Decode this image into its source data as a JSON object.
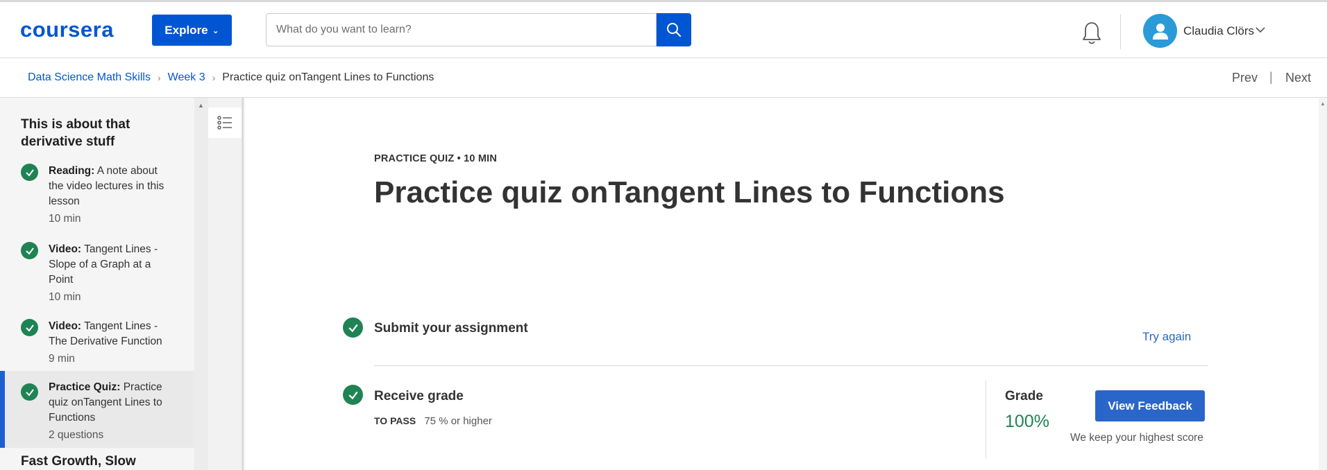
{
  "header": {
    "logo_text": "coursera",
    "explore_label": "Explore",
    "search_placeholder": "What do you want to learn?",
    "user_name": "Claudia Clörs",
    "brand_color": "#0056d2"
  },
  "breadcrumb": {
    "items": [
      "Data Science Math Skills",
      "Week 3"
    ],
    "current": "Practice quiz onTangent Lines to Functions",
    "prev_label": "Prev",
    "separator": "|",
    "next_label": "Next"
  },
  "sidebar": {
    "section_title": "This is about that derivative stuff",
    "items": [
      {
        "type": "Reading:",
        "title": "A note about the video lectures in this lesson",
        "meta": "10 min",
        "completed": true
      },
      {
        "type": "Video:",
        "title": "Tangent Lines - Slope of a Graph at a Point",
        "meta": "10 min",
        "completed": true
      },
      {
        "type": "Video:",
        "title": "Tangent Lines - The Derivative Function",
        "meta": "9 min",
        "completed": true
      },
      {
        "type": "Practice Quiz:",
        "title": "Practice quiz onTangent Lines to Functions",
        "meta": "2 questions",
        "completed": true,
        "active": true
      }
    ],
    "next_section_title": "Fast Growth, Slow"
  },
  "main": {
    "eyebrow": "PRACTICE QUIZ • 10 MIN",
    "title": "Practice quiz onTangent Lines to Functions",
    "steps": {
      "submit_label": "Submit your assignment",
      "try_again_label": "Try again",
      "receive_label": "Receive grade",
      "to_pass_label": "TO PASS",
      "to_pass_value": "75 % or higher"
    },
    "grade": {
      "label": "Grade",
      "value": "100%",
      "feedback_button": "View Feedback",
      "note": "We keep your highest score"
    },
    "success_color": "#1f8354"
  }
}
